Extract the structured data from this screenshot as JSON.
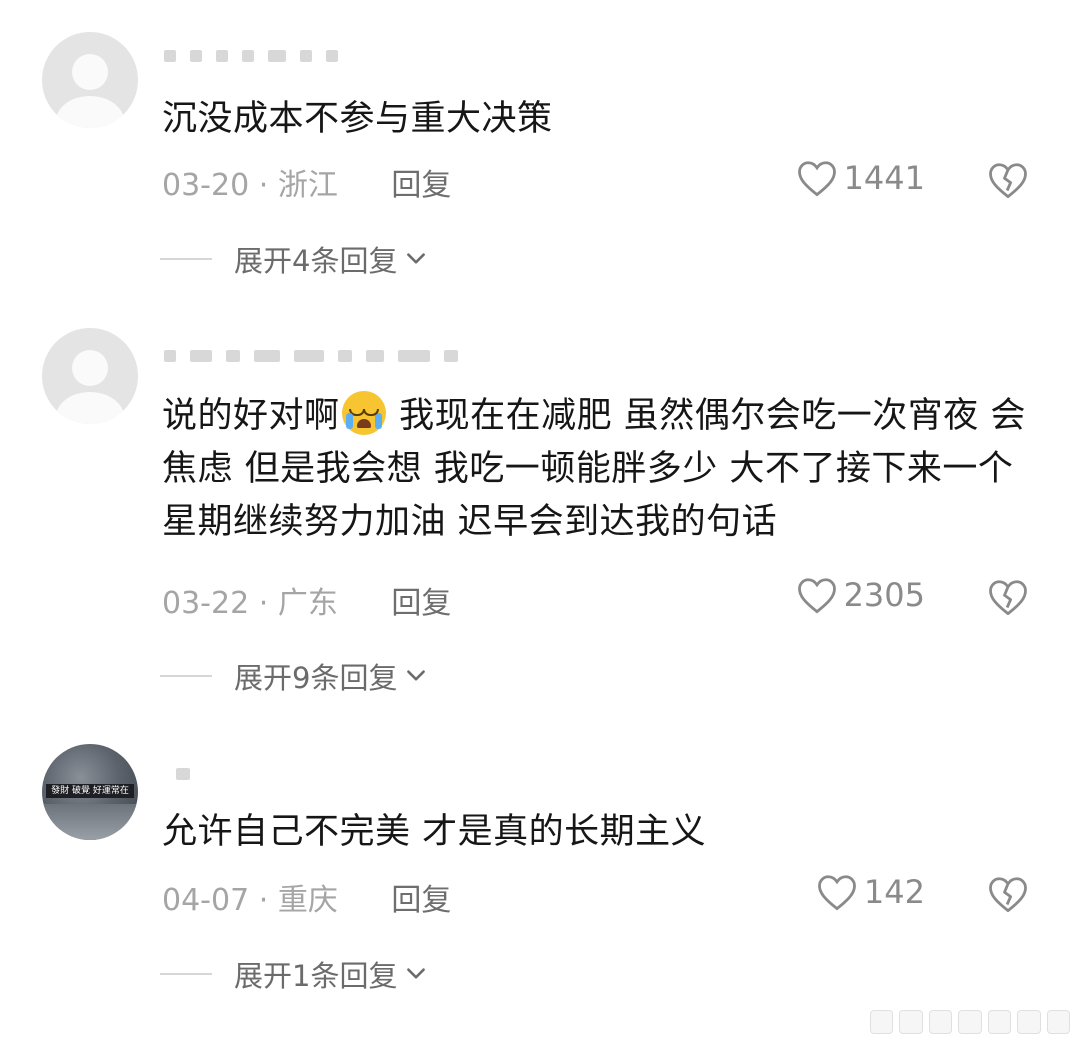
{
  "comments": [
    {
      "text": "沉没成本不参与重大决策",
      "date": "03-20",
      "separator": "·",
      "location": "浙江",
      "reply_label": "回复",
      "likes": "1441",
      "expand_label": "展开4条回复"
    },
    {
      "text_before_emoji": "说的好对啊",
      "emoji": "crying-face-emoji",
      "text_after_emoji": " 我现在在减肥 虽然偶尔会吃一次宵夜 会焦虑 但是我会想 我吃一顿能胖多少 大不了接下来一个星期继续努力加油 迟早会到达我的句话",
      "date": "03-22",
      "separator": "·",
      "location": "广东",
      "reply_label": "回复",
      "likes": "2305",
      "expand_label": "展开9条回复"
    },
    {
      "text": "允许自己不完美 才是真的长期主义",
      "date": "04-07",
      "separator": "·",
      "location": "重庆",
      "reply_label": "回复",
      "likes": "142",
      "expand_label": "展开1条回复",
      "avatar_sign_text": "發財 破覺 好運常在"
    }
  ],
  "colors": {
    "meta_gray": "#a5a5a5",
    "text": "#161616",
    "icon_gray": "#8a8a8a"
  }
}
